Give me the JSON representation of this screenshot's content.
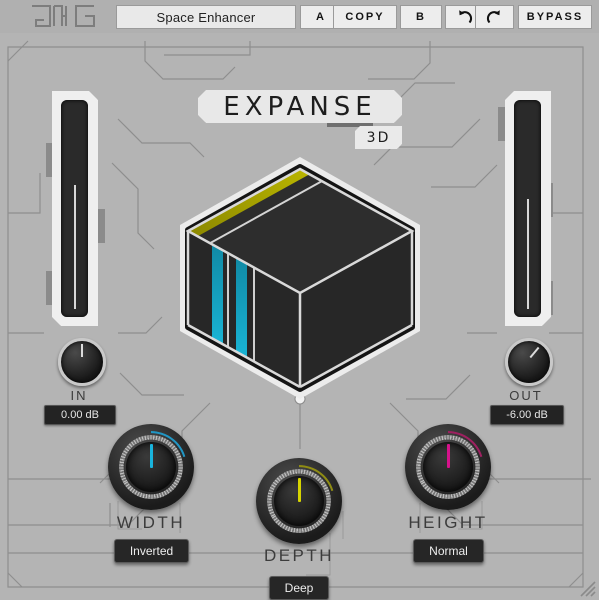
{
  "header": {
    "logo_name": "jmg-logo",
    "preset": {
      "value": "Space Enhancer",
      "placeholder": "Preset name"
    },
    "buttons": [
      {
        "id": "a",
        "label": "A",
        "icon": ""
      },
      {
        "id": "copy",
        "label": "COPY",
        "icon": ""
      },
      {
        "id": "b",
        "label": "B",
        "icon": ""
      },
      {
        "id": "undo",
        "label": "",
        "icon": "undo-arrow-icon"
      },
      {
        "id": "redo",
        "label": "",
        "icon": "redo-arrow-icon"
      },
      {
        "id": "bypass",
        "label": "BYPASS",
        "icon": ""
      }
    ]
  },
  "title": {
    "name": "EXPANSE",
    "badge": "3D"
  },
  "meters": {
    "input": {
      "label": "IN",
      "value": "0.00 dB",
      "level_pct": 62,
      "knob_angle": 0
    },
    "output": {
      "label": "OUT",
      "value": "-6.00 dB",
      "level_pct": 55,
      "knob_angle": 40
    }
  },
  "knobs": [
    {
      "id": "width",
      "label": "WIDTH",
      "value": "Inverted",
      "arc_color": "#2196c4",
      "pointer_color": "#19b4dd",
      "angle": 0,
      "arc_start": -135,
      "arc_sweep": 118
    },
    {
      "id": "depth",
      "label": "DEPTH",
      "value": "Deep",
      "arc_color": "#8f8c13",
      "pointer_color": "#d6d400",
      "angle": 0,
      "arc_start": -135,
      "arc_sweep": 118
    },
    {
      "id": "height",
      "label": "HEIGHT",
      "value": "Normal",
      "arc_color": "#9e2060",
      "pointer_color": "#d6128b",
      "angle": 0,
      "arc_start": -135,
      "arc_sweep": 118
    }
  ],
  "cube": {
    "name": "expanse-3d-cube",
    "top_face_color": "#2b2b2b",
    "left_face_color": "#262626",
    "right_face_color": "#262626",
    "top_stripe_color": "#d9d400",
    "left_stripe_color": "#13b2d6",
    "right_stripe_color": "#d6128b",
    "frame_color": "#ececec",
    "body_color": "#1e1e1e"
  },
  "colors": {
    "background": "#b4b4b4",
    "panel": "#b4b4b4",
    "trace": "#8e8e8e",
    "plate": "#e8e8e8",
    "readout_bg": "#262626",
    "readout_text": "#ededed"
  },
  "resize_grip": "resize-grip"
}
